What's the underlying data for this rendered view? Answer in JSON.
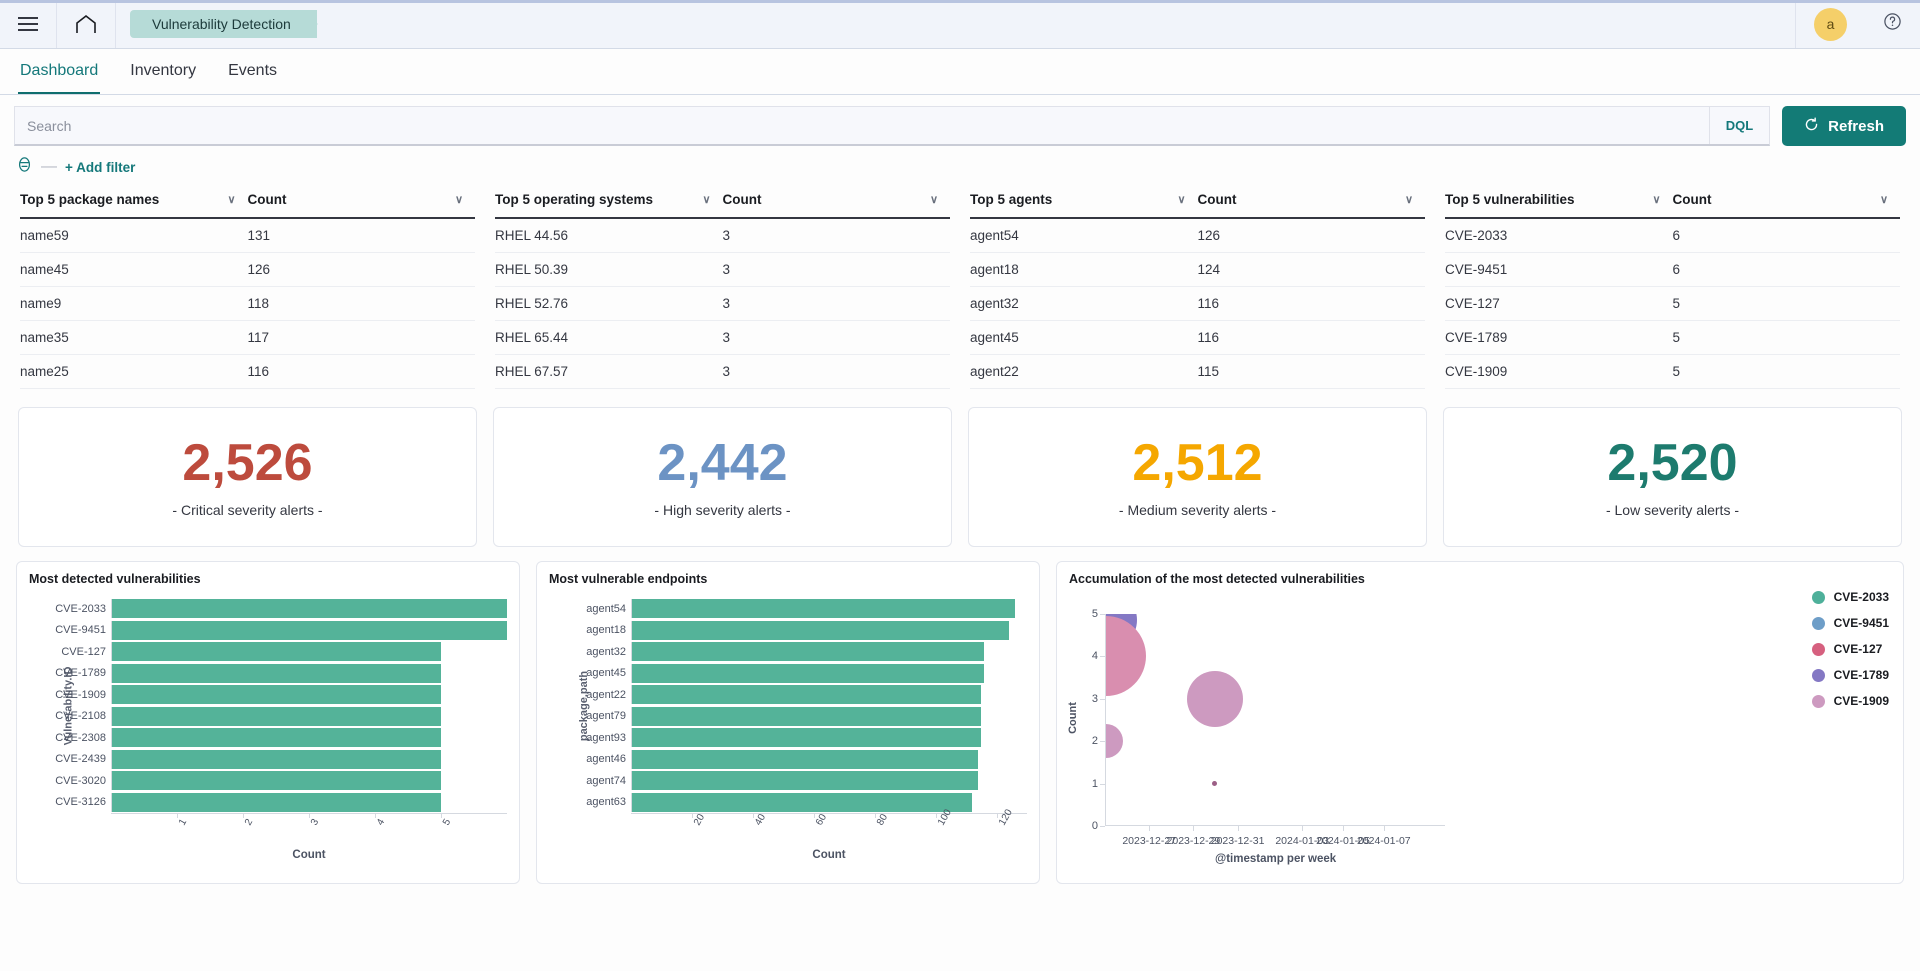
{
  "chrome": {
    "menu_icon": "hamburger-icon",
    "home_icon": "home-icon",
    "breadcrumb": "Vulnerability Detection",
    "avatar_initial": "a",
    "help_icon": "help-circle-icon"
  },
  "tabs": [
    {
      "label": "Dashboard",
      "active": true
    },
    {
      "label": "Inventory",
      "active": false
    },
    {
      "label": "Events",
      "active": false
    }
  ],
  "search": {
    "placeholder": "Search",
    "value": "",
    "dql_label": "DQL",
    "refresh_label": "Refresh",
    "refresh_icon": "refresh-icon",
    "filter_icon": "filter-list-icon",
    "dash": "—",
    "add_filter_label": "+ Add filter"
  },
  "tables": [
    {
      "name": "top-5-package-names",
      "headers": [
        "Top 5 package names",
        "Count"
      ],
      "rows": [
        [
          "name59",
          "131"
        ],
        [
          "name45",
          "126"
        ],
        [
          "name9",
          "118"
        ],
        [
          "name35",
          "117"
        ],
        [
          "name25",
          "116"
        ]
      ]
    },
    {
      "name": "top-5-operating-systems",
      "headers": [
        "Top 5 operating systems",
        "Count"
      ],
      "rows": [
        [
          "RHEL 44.56",
          "3"
        ],
        [
          "RHEL 50.39",
          "3"
        ],
        [
          "RHEL 52.76",
          "3"
        ],
        [
          "RHEL 65.44",
          "3"
        ],
        [
          "RHEL 67.57",
          "3"
        ]
      ]
    },
    {
      "name": "top-5-agents",
      "headers": [
        "Top 5 agents",
        "Count"
      ],
      "rows": [
        [
          "agent54",
          "126"
        ],
        [
          "agent18",
          "124"
        ],
        [
          "agent32",
          "116"
        ],
        [
          "agent45",
          "116"
        ],
        [
          "agent22",
          "115"
        ]
      ]
    },
    {
      "name": "top-5-vulnerabilities",
      "headers": [
        "Top 5 vulnerabilities",
        "Count"
      ],
      "rows": [
        [
          "CVE-2033",
          "6"
        ],
        [
          "CVE-9451",
          "6"
        ],
        [
          "CVE-127",
          "5"
        ],
        [
          "CVE-1789",
          "5"
        ],
        [
          "CVE-1909",
          "5"
        ]
      ]
    }
  ],
  "metrics": [
    {
      "value": "2,526",
      "label": "- Critical severity alerts -",
      "color": "#bd4b3d"
    },
    {
      "value": "2,442",
      "label": "- High severity alerts -",
      "color": "#6c93c4"
    },
    {
      "value": "2,512",
      "label": "- Medium severity alerts -",
      "color": "#f5a700"
    },
    {
      "value": "2,520",
      "label": "- Low severity alerts -",
      "color": "#1d7b6e"
    }
  ],
  "chart_data": [
    {
      "name": "most-detected-vulnerabilities",
      "type": "bar",
      "orientation": "horizontal",
      "title": "Most detected vulnerabilities",
      "xlabel": "Count",
      "ylabel": "Vulnerability.ID",
      "categories": [
        "CVE-2033",
        "CVE-9451",
        "CVE-127",
        "CVE-1789",
        "CVE-1909",
        "CVE-2108",
        "CVE-2308",
        "CVE-2439",
        "CVE-3020",
        "CVE-3126"
      ],
      "values": [
        6,
        6,
        5,
        5,
        5,
        5,
        5,
        5,
        5,
        5
      ],
      "xticks": [
        "1",
        "2",
        "3",
        "4",
        "5"
      ],
      "xtickvalues": [
        1,
        2,
        3,
        4,
        5
      ],
      "xlim": [
        0,
        6
      ],
      "grid": false,
      "bar_color": "#54b399"
    },
    {
      "name": "most-vulnerable-endpoints",
      "type": "bar",
      "orientation": "horizontal",
      "title": "Most vulnerable endpoints",
      "xlabel": "Count",
      "ylabel": "package.path",
      "categories": [
        "agent54",
        "agent18",
        "agent32",
        "agent45",
        "agent22",
        "agent79",
        "agent93",
        "agent46",
        "agent74",
        "agent63"
      ],
      "values": [
        126,
        124,
        116,
        116,
        115,
        115,
        115,
        114,
        114,
        112
      ],
      "xticks": [
        "20",
        "40",
        "60",
        "80",
        "100",
        "120"
      ],
      "xtickvalues": [
        20,
        40,
        60,
        80,
        100,
        120
      ],
      "xlim": [
        0,
        130
      ],
      "grid": false,
      "bar_color": "#54b399"
    },
    {
      "name": "accumulation-of-most-detected-vulnerabilities",
      "type": "scatter",
      "title": "Accumulation of the most detected vulnerabilities",
      "xlabel": "@timestamp per week",
      "ylabel": "Count",
      "yticks": [
        "0",
        "1",
        "2",
        "3",
        "4",
        "5"
      ],
      "ylim": [
        0,
        5
      ],
      "xticks": [
        "2023-12-27",
        "2023-12-29",
        "2023-12-31",
        "2024-01-03",
        "2024-01-05",
        "2024-01-07"
      ],
      "grid": false,
      "legend_position": "right",
      "legend": [
        {
          "label": "CVE-2033",
          "color": "#4eb09a"
        },
        {
          "label": "CVE-9451",
          "color": "#6e9ec8"
        },
        {
          "label": "CVE-127",
          "color": "#d6607f"
        },
        {
          "label": "CVE-1789",
          "color": "#8478c4"
        },
        {
          "label": "CVE-1909",
          "color": "#cd9ac0"
        }
      ],
      "points": [
        {
          "series": "CVE-1789",
          "x_pct": 0,
          "y": 4.85,
          "size": 62,
          "color": "#8478c4"
        },
        {
          "series": "CVE-127",
          "x_pct": 0,
          "y": 4.0,
          "size": 80,
          "color": "#d98eaf"
        },
        {
          "series": "CVE-1909",
          "x_pct": 0,
          "y": 2.0,
          "size": 34,
          "color": "#cd9ac0"
        },
        {
          "series": "CVE-1909",
          "x_pct": 32,
          "y": 3.0,
          "size": 56,
          "color": "#cd9ac0"
        },
        {
          "series": "CVE-127",
          "x_pct": 32,
          "y": 1.0,
          "size": 5,
          "color": "#9c5f86"
        }
      ]
    }
  ]
}
